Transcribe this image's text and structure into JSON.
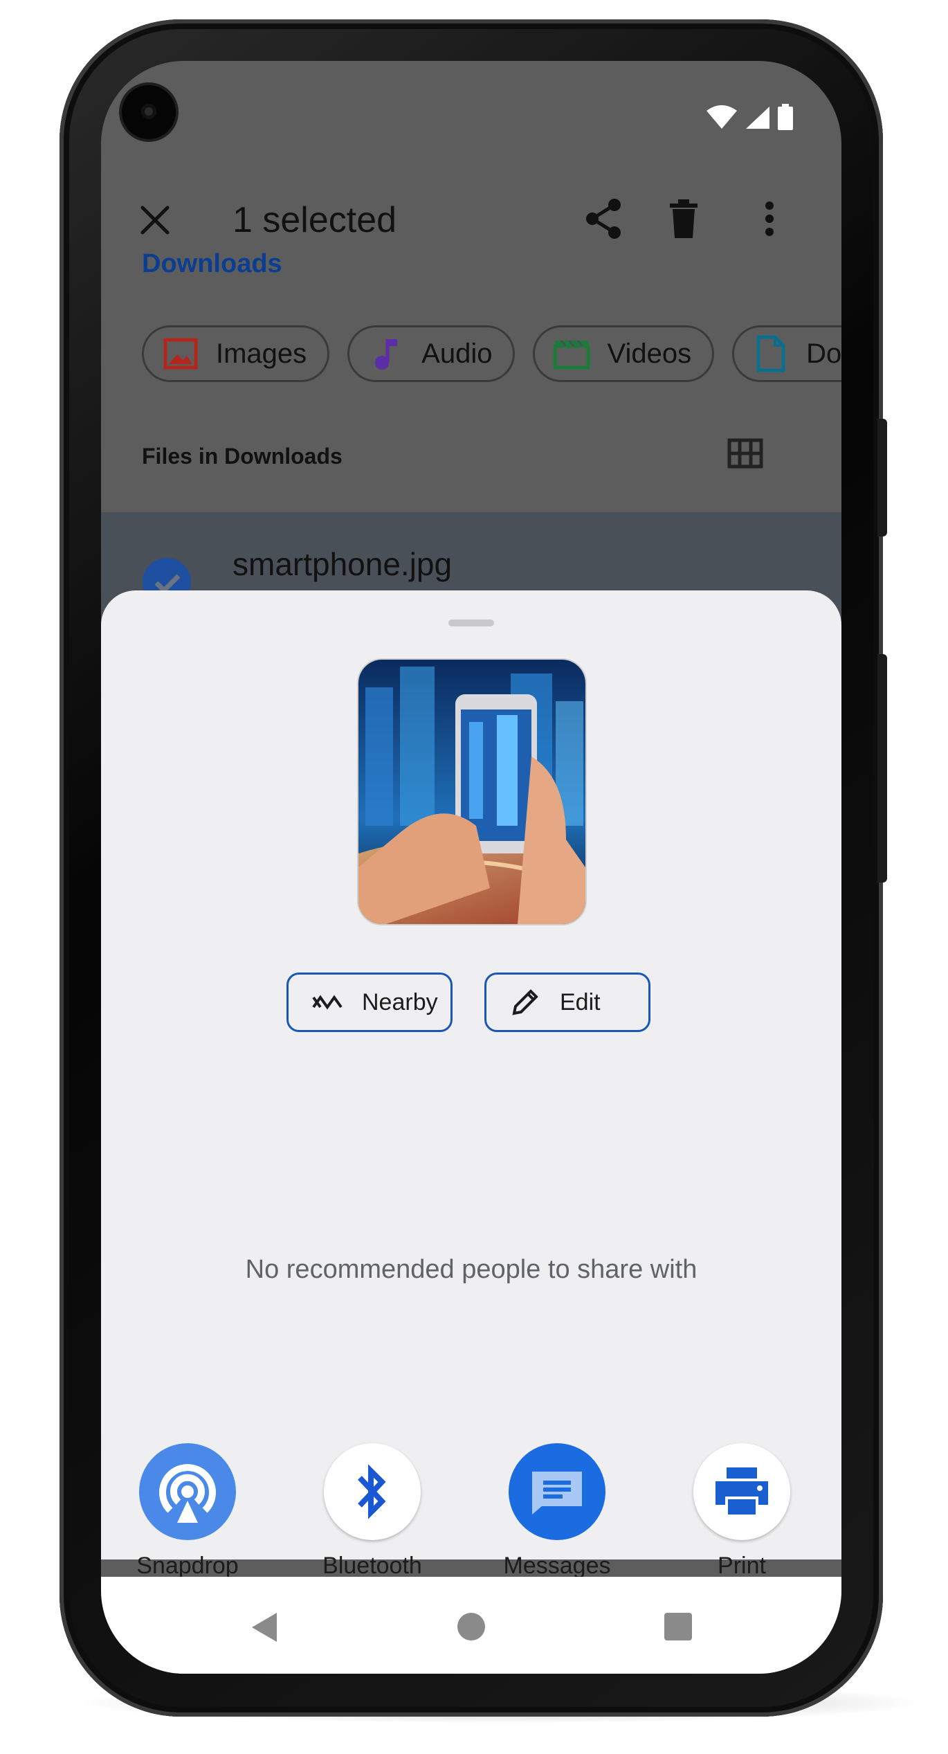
{
  "appbar": {
    "title": "1 selected",
    "close_icon": "close-icon",
    "share_icon": "share-icon",
    "delete_icon": "delete-icon",
    "more_icon": "more-vert-icon"
  },
  "breadcrumb": "Downloads",
  "chips": [
    {
      "label": "Images",
      "icon": "image-icon",
      "color": "#b3261e"
    },
    {
      "label": "Audio",
      "icon": "music-note-icon",
      "color": "#5b2ea8"
    },
    {
      "label": "Videos",
      "icon": "movie-icon",
      "color": "#1e7a3a"
    },
    {
      "label": "Doc",
      "icon": "document-icon",
      "color": "#0b6e8a"
    }
  ],
  "section": {
    "label": "Files in Downloads",
    "view_icon": "grid-view-icon"
  },
  "file": {
    "name": "smartphone.jpg",
    "selected": true
  },
  "share_sheet": {
    "preview_icon": "image-preview",
    "actions": [
      {
        "label": "Nearby",
        "icon": "nearby-share-icon"
      },
      {
        "label": "Edit",
        "icon": "pencil-icon"
      }
    ],
    "empty_message": "No recommended people to share with",
    "targets": [
      {
        "label": "Snapdrop",
        "icon": "snapdrop-icon"
      },
      {
        "label": "Bluetooth",
        "icon": "bluetooth-icon"
      },
      {
        "label": "Messages",
        "icon": "messages-icon"
      },
      {
        "label": "Print",
        "icon": "printer-icon"
      }
    ]
  },
  "colors": {
    "accent": "#1a57b5",
    "sheet_bg": "#efeff2",
    "scrim": "#5d5d5d"
  }
}
